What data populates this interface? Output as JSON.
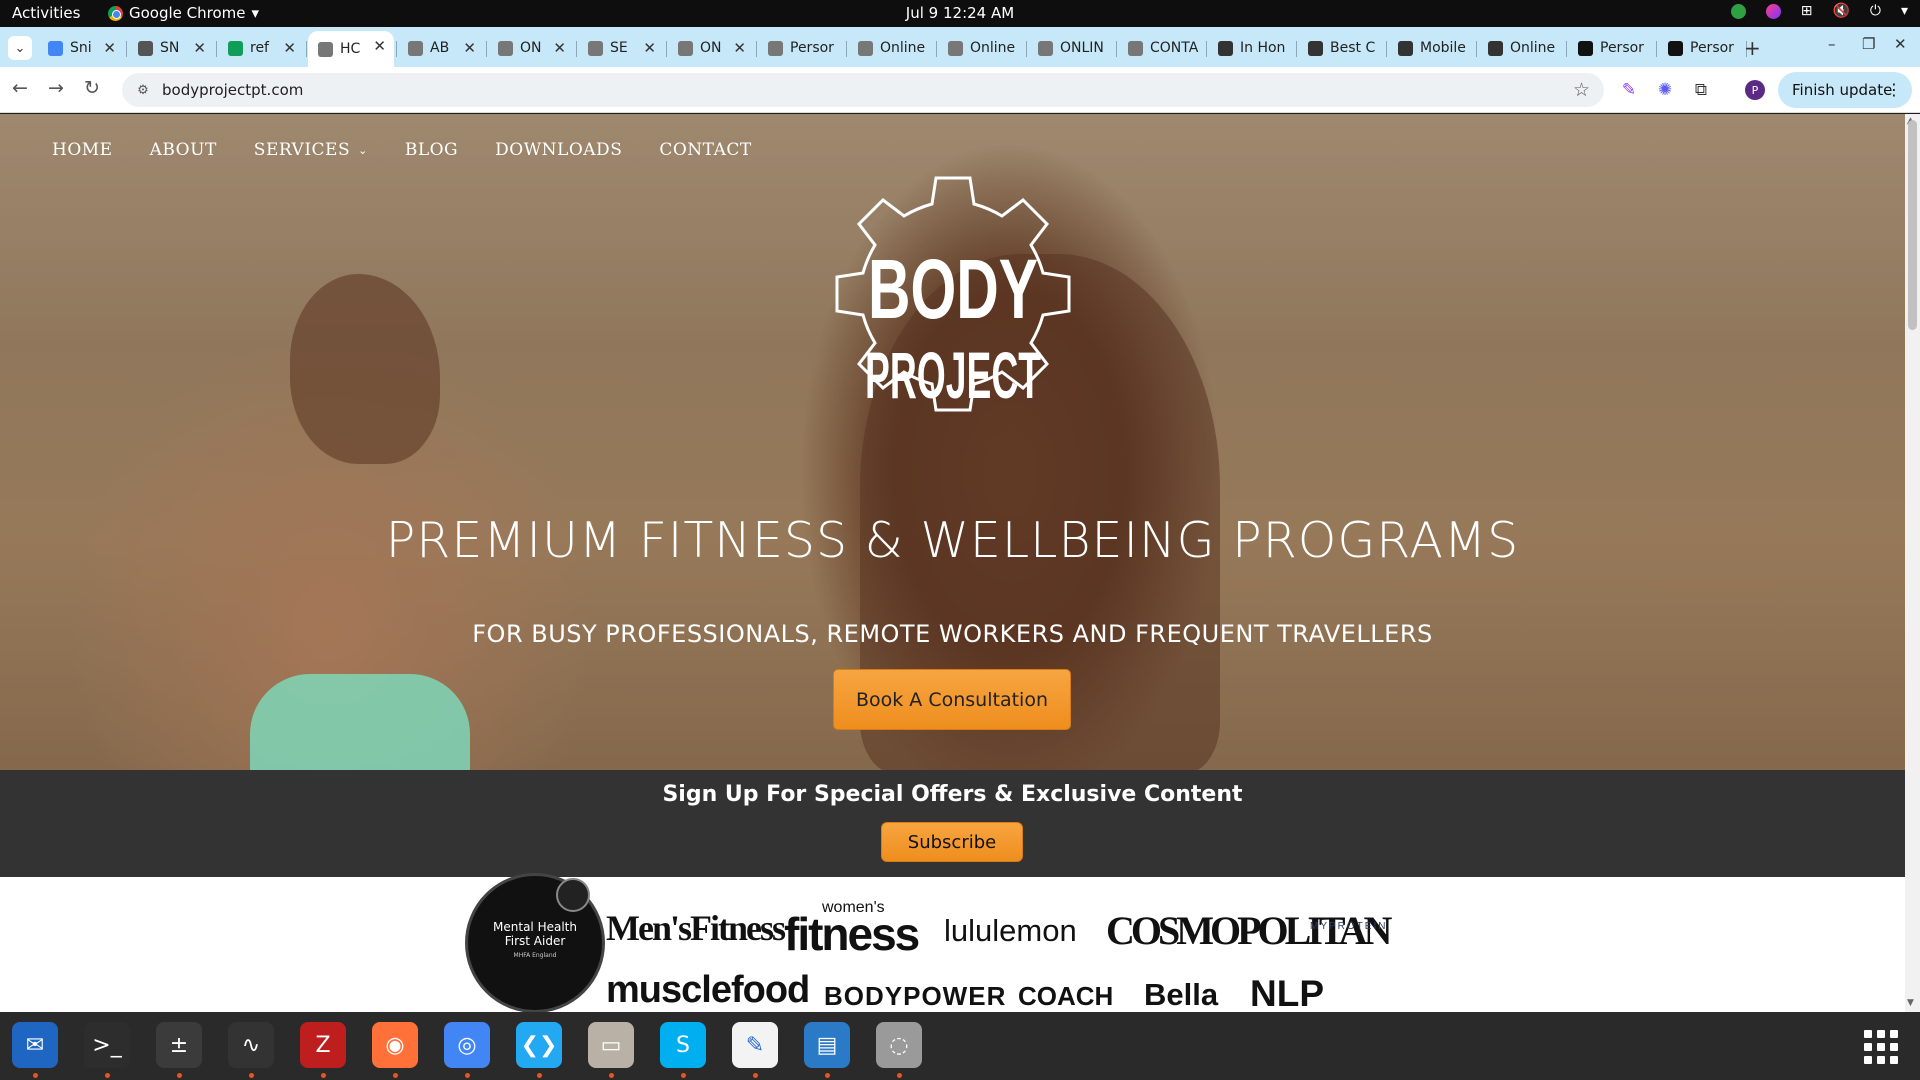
{
  "system_bar": {
    "activities": "Activities",
    "app_name": "Google Chrome",
    "datetime": "Jul 9  12:24 AM"
  },
  "tabs": [
    {
      "title": "Sni",
      "icon": "google-docs-icon",
      "color": "#4285f4"
    },
    {
      "title": "SN",
      "icon": "dataset-icon",
      "color": "#555555"
    },
    {
      "title": "ref",
      "icon": "google-sheets-icon",
      "color": "#0f9d58"
    },
    {
      "title": "HC",
      "icon": "site-icon",
      "color": "#777777",
      "active": true
    },
    {
      "title": "AB",
      "icon": "site-icon",
      "color": "#777777"
    },
    {
      "title": "ON",
      "icon": "site-icon",
      "color": "#777777"
    },
    {
      "title": "SE",
      "icon": "site-icon",
      "color": "#777777"
    },
    {
      "title": "ON",
      "icon": "site-icon",
      "color": "#777777"
    },
    {
      "title": "Persor",
      "icon": "site-icon",
      "color": "#777777"
    },
    {
      "title": "Online",
      "icon": "site-icon",
      "color": "#777777"
    },
    {
      "title": "Online",
      "icon": "site-icon",
      "color": "#777777"
    },
    {
      "title": "ONLIN",
      "icon": "site-icon",
      "color": "#777777"
    },
    {
      "title": "CONTA",
      "icon": "site-icon",
      "color": "#777777"
    },
    {
      "title": "In Hon",
      "icon": "globe-icon",
      "color": "#333333"
    },
    {
      "title": "Best C",
      "icon": "globe-icon",
      "color": "#333333"
    },
    {
      "title": "Mobile",
      "icon": "arch-icon",
      "color": "#333333"
    },
    {
      "title": "Online",
      "icon": "arch-icon",
      "color": "#333333"
    },
    {
      "title": "Persor",
      "icon": "fs-icon",
      "color": "#111111"
    },
    {
      "title": "Persor",
      "icon": "fs-icon",
      "color": "#111111"
    }
  ],
  "omnibox": {
    "url": "bodyprojectpt.com",
    "finish_update": "Finish update",
    "profile_initial": "P"
  },
  "site": {
    "nav": [
      {
        "label": "HOME"
      },
      {
        "label": "ABOUT"
      },
      {
        "label": "SERVICES",
        "has_dropdown": true
      },
      {
        "label": "BLOG"
      },
      {
        "label": "DOWNLOADS"
      },
      {
        "label": "CONTACT"
      }
    ],
    "logo": {
      "line1": "BODY",
      "line2": "PROJECT"
    },
    "hero_title": "PREMIUM FITNESS & WELLBEING PROGRAMS",
    "hero_subtitle": "FOR BUSY PROFESSIONALS, REMOTE WORKERS AND FREQUENT TRAVELLERS",
    "cta_label": "Book A Consultation",
    "signup_title": "Sign Up For Special Offers & Exclusive Content",
    "subscribe_label": "Subscribe",
    "badge": {
      "line1": "Mental Health",
      "line2": "First Aider",
      "line3": "MHFA England"
    },
    "press_row1": [
      "Men'sFitness",
      "women's",
      "fitness",
      "lululemon",
      "COSMOPOLITAN",
      "MYPROTEIN"
    ],
    "press_row2": [
      "musclefood",
      "BODYPOWER",
      "COACH",
      "Bella",
      "NLP"
    ]
  },
  "colors": {
    "accent_orange": "#f39a2c",
    "signup_bg": "#333333",
    "tabstrip_bg": "#c7e8f8"
  },
  "dock": [
    {
      "name": "thunderbird-icon",
      "color": "#1f66c2"
    },
    {
      "name": "terminal-icon",
      "color": "#2d2d2d"
    },
    {
      "name": "calculator-icon",
      "color": "#3b3b3b"
    },
    {
      "name": "system-monitor-icon",
      "color": "#333333"
    },
    {
      "name": "filezilla-icon",
      "color": "#bf1e1e"
    },
    {
      "name": "firefox-icon",
      "color": "#ff7139"
    },
    {
      "name": "chrome-icon",
      "color": "#4285f4"
    },
    {
      "name": "vscode-icon",
      "color": "#23a9f2"
    },
    {
      "name": "files-icon",
      "color": "#b9b1a6"
    },
    {
      "name": "skype-icon",
      "color": "#00aff0"
    },
    {
      "name": "text-editor-icon",
      "color": "#f3f3f3"
    },
    {
      "name": "libreoffice-writer-icon",
      "color": "#2a7ac7"
    },
    {
      "name": "disks-icon",
      "color": "#9a9a9a"
    }
  ]
}
